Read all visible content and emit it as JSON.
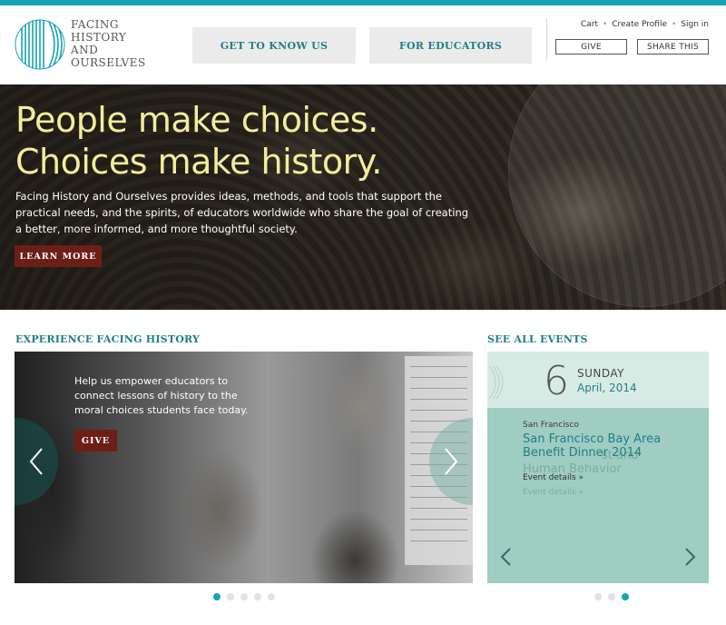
{
  "brand": {
    "logo_lines": [
      "FACING",
      "HISTORY",
      "AND",
      "OURSELVES"
    ],
    "accent_color": "#16a3b1",
    "heading_color": "#1f7f86",
    "button_color": "#6d1f17"
  },
  "nav": {
    "get_to_know": "GET TO KNOW US",
    "for_educators": "FOR EDUCATORS"
  },
  "utility": {
    "cart": "Cart",
    "sep": "•",
    "create_profile": "Create Profile",
    "sign_in": "Sign in",
    "give": "GIVE",
    "share": "SHARE THIS"
  },
  "hero": {
    "title_line1": "People make choices.",
    "title_line2": "Choices make history.",
    "body": "Facing History and Ourselves provides ideas, methods, and tools that support the practical needs, and the spirits, of educators worldwide who share the goal of creating a better, more informed, and more thoughtful society.",
    "cta": "LEARN MORE"
  },
  "experience": {
    "heading": "EXPERIENCE FACING HISTORY",
    "caption": "Help us empower educators to connect lessons of history to the moral choices students face today.",
    "cta": "GIVE",
    "slide_count": 5,
    "active_slide": 1
  },
  "events": {
    "heading": "SEE ALL EVENTS",
    "day": "6",
    "weekday": "SUNDAY",
    "month_year": "April, 2014",
    "city": "San Francisco",
    "title": "San Francisco Bay Area Benefit Dinner 2014",
    "details": "Event details »",
    "ghost_title_tail": "st and",
    "ghost_title_line2": "Human Behavior",
    "slide_count": 3,
    "active_slide": 3
  },
  "icons": [
    "logo-mark-icon",
    "chevron-left-icon",
    "chevron-right-icon"
  ]
}
